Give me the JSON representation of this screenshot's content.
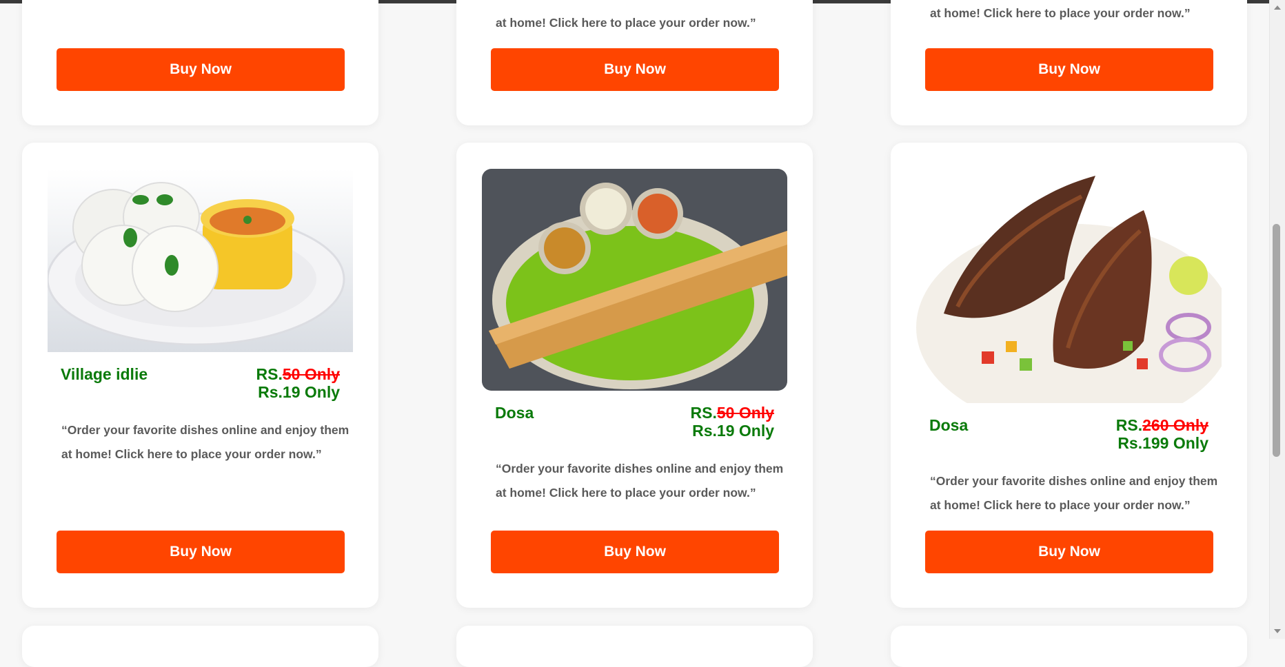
{
  "colors": {
    "accent": "#ff4500",
    "green": "#0a7a0a",
    "strike": "#ff0000"
  },
  "top_cards": [
    {
      "desc_line2": "at home! Click here to place your order now.”",
      "button_label": "Buy Now"
    },
    {
      "desc_line2": "at home! Click here to place your order now.”",
      "button_label": "Buy Now"
    },
    {
      "desc_line2": "at home! Click here to place your order now.”",
      "button_label": "Buy Now"
    }
  ],
  "cards": [
    {
      "name": "Village idlie",
      "price_prefix": "RS.",
      "old_price": "50 Only",
      "new_price": "Rs.19 Only",
      "description": "“Order your favorite dishes online and enjoy them at home! Click here to place your order now.”",
      "button_label": "Buy Now",
      "image_icon": "idli-plate-image"
    },
    {
      "name": "Dosa",
      "price_prefix": "RS.",
      "old_price": "50 Only",
      "new_price": "Rs.19 Only",
      "description": "“Order your favorite dishes online and enjoy them at home! Click here to place your order now.”",
      "button_label": "Buy Now",
      "image_icon": "dosa-plate-image"
    },
    {
      "name": "Dosa",
      "price_prefix": "RS.",
      "old_price": "260 Only",
      "new_price": "Rs.199 Only",
      "description": "“Order your favorite dishes online and enjoy them at home! Click here to place your order now.”",
      "button_label": "Buy Now",
      "image_icon": "fish-fry-image"
    }
  ]
}
